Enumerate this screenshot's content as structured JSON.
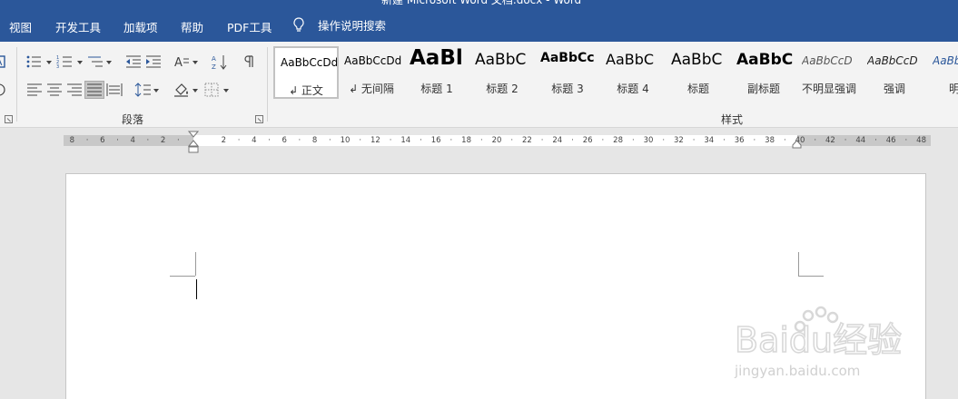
{
  "window": {
    "title": "新建 Microsoft Word 文档.docx - Word"
  },
  "menu": {
    "tabs": [
      "视图",
      "开发工具",
      "加载项",
      "帮助",
      "PDF工具"
    ],
    "tell_me": "操作说明搜索"
  },
  "ribbon": {
    "paragraph_group_label": "段落",
    "styles_group_label": "样式",
    "styles": [
      {
        "preview": "AaBbCcDd",
        "name": "↲ 正文",
        "selected": true
      },
      {
        "preview": "AaBbCcDd",
        "name": "↲ 无间隔"
      },
      {
        "preview": "AaBl",
        "name": "标题 1"
      },
      {
        "preview": "AaBbC",
        "name": "标题 2"
      },
      {
        "preview": "AaBbCc",
        "name": "标题 3"
      },
      {
        "preview": "AaBbC",
        "name": "标题 4"
      },
      {
        "preview": "AaBbC",
        "name": "标题"
      },
      {
        "preview": "AaBbC",
        "name": "副标题"
      },
      {
        "preview": "AaBbCcD",
        "name": "不明显强调"
      },
      {
        "preview": "AaBbCcD",
        "name": "强调"
      },
      {
        "preview": "AaBb",
        "name": "明显"
      }
    ]
  },
  "ruler": {
    "labels": [
      "8",
      "6",
      "4",
      "2",
      "2",
      "4",
      "6",
      "8",
      "10",
      "12",
      "14",
      "16",
      "18",
      "20",
      "22",
      "24",
      "26",
      "28",
      "30",
      "32",
      "34",
      "36",
      "38",
      "40",
      "42",
      "44",
      "46",
      "48"
    ]
  },
  "watermark": {
    "brand": "Baidu经验",
    "url": "jingyan.baidu.com"
  }
}
